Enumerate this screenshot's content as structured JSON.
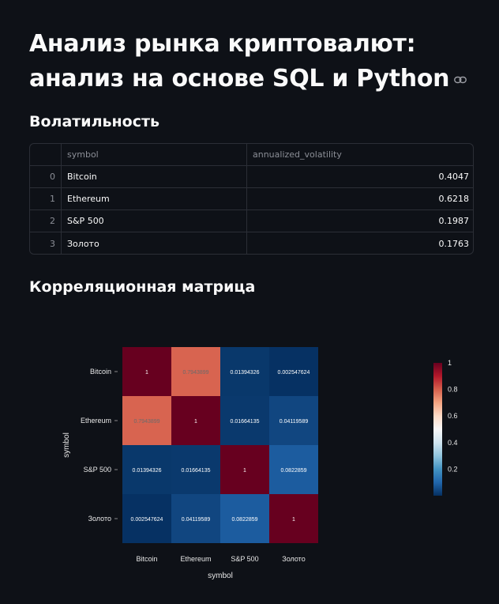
{
  "title": "Анализ рынка криптовалют: анализ на основе SQL и Python",
  "sections": {
    "volatility_heading": "Волатильность",
    "correlation_heading": "Корреляционная матрица"
  },
  "table": {
    "columns": [
      "",
      "symbol",
      "annualized_volatility"
    ],
    "rows": [
      {
        "index": "0",
        "symbol": "Bitcoin",
        "annualized_volatility": "0.4047"
      },
      {
        "index": "1",
        "symbol": "Ethereum",
        "annualized_volatility": "0.6218"
      },
      {
        "index": "2",
        "symbol": "S&P 500",
        "annualized_volatility": "0.1987"
      },
      {
        "index": "3",
        "symbol": "Золото",
        "annualized_volatility": "0.1763"
      }
    ]
  },
  "chart_data": {
    "type": "heatmap",
    "title": "",
    "xlabel": "symbol",
    "ylabel": "symbol",
    "categories": [
      "Bitcoin",
      "Ethereum",
      "S&P 500",
      "Золото"
    ],
    "values": [
      [
        1,
        0.7943899,
        0.01394326,
        0.002547624
      ],
      [
        0.7943899,
        1,
        0.01664135,
        0.04119589
      ],
      [
        0.01394326,
        0.01664135,
        1,
        0.0822859
      ],
      [
        0.002547624,
        0.04119589,
        0.0822859,
        1
      ]
    ],
    "labels": [
      [
        "1",
        "0.7943899",
        "0.01394326",
        "0.002547624"
      ],
      [
        "0.7943899",
        "1",
        "0.01664135",
        "0.04119589"
      ],
      [
        "0.01394326",
        "0.01664135",
        "1",
        "0.0822859"
      ],
      [
        "0.002547624",
        "0.04119589",
        "0.0822859",
        "1"
      ]
    ],
    "colorscale": "RdBu_r",
    "colorbar": {
      "ticks": [
        "0.2",
        "0.4",
        "0.6",
        "0.8",
        "1"
      ],
      "range": [
        0,
        1
      ]
    }
  }
}
